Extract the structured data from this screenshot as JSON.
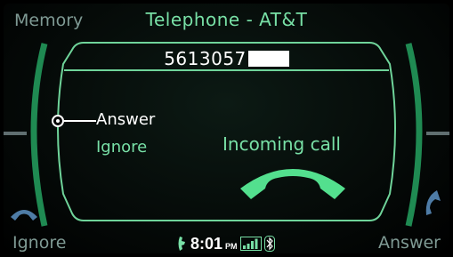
{
  "header": {
    "left_label": "Memory",
    "title": "Telephone -  AT&T"
  },
  "call": {
    "number": "5613057",
    "status": "Incoming call"
  },
  "menu": {
    "items": [
      {
        "label": "Answer",
        "selected": true
      },
      {
        "label": "Ignore",
        "selected": false
      }
    ]
  },
  "softkeys": {
    "left": "Ignore",
    "right": "Answer"
  },
  "status_bar": {
    "time": "8:01",
    "ampm": "PM",
    "icons": [
      "phone-status-icon",
      "signal-strength-icon",
      "bluetooth-icon"
    ]
  },
  "colors": {
    "accent_green": "#78e0a6",
    "frame_green": "#1f8a52",
    "muted_gray": "#7f9a94"
  }
}
